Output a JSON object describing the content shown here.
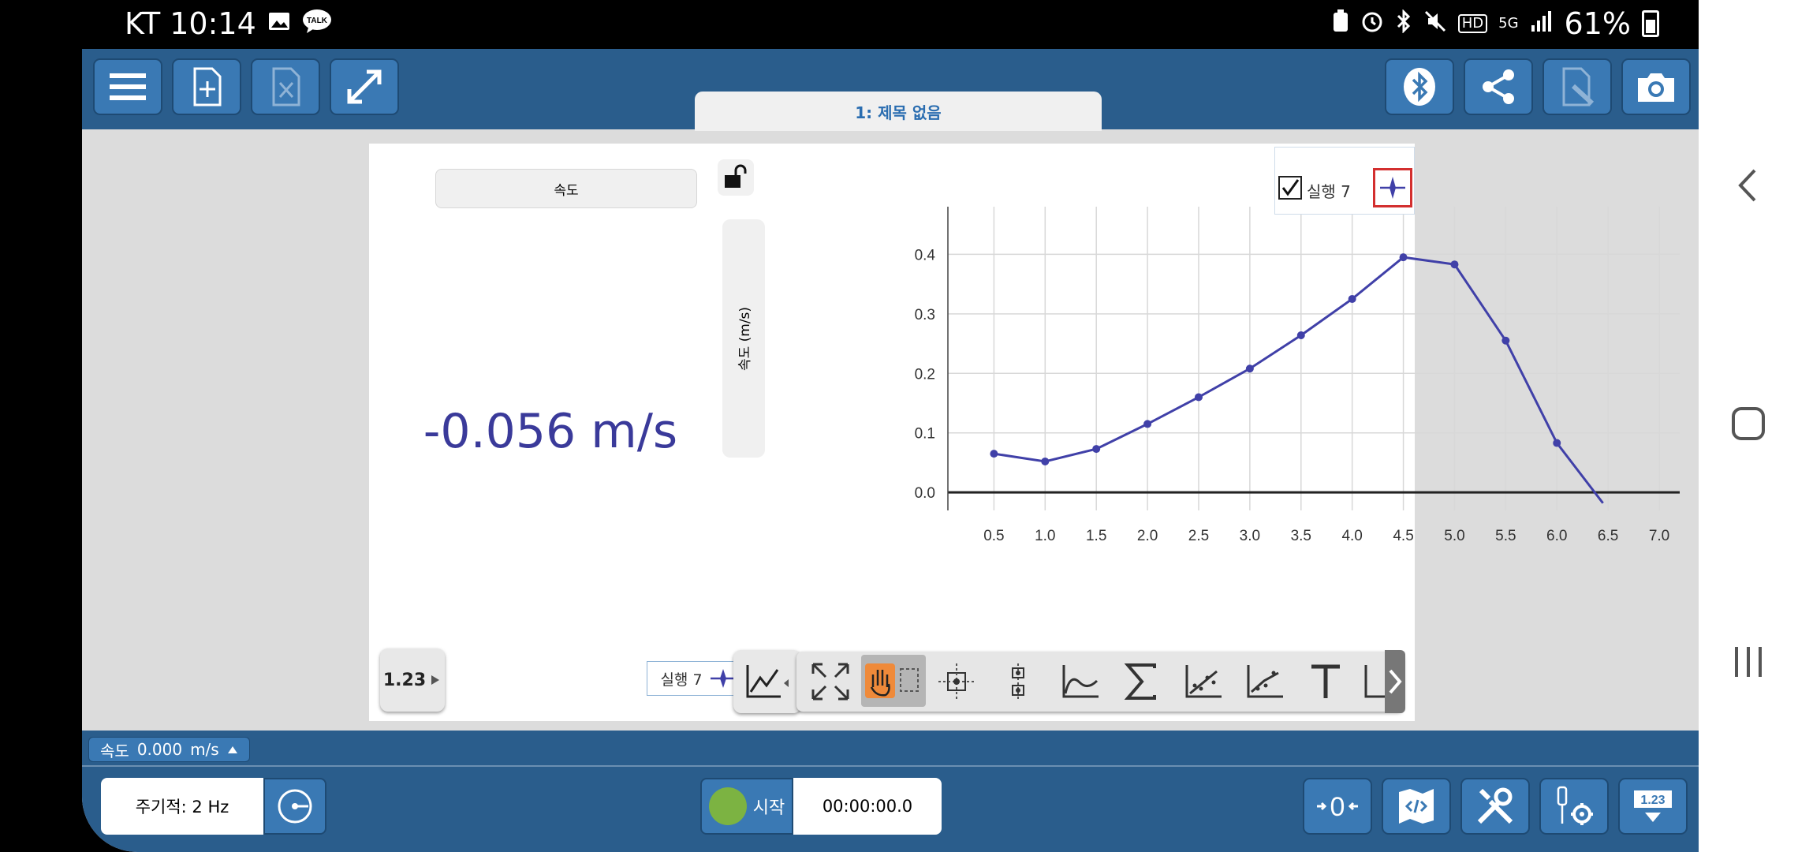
{
  "status_bar": {
    "carrier_time": "KT 10:14",
    "battery": "61%",
    "icons": [
      "image-icon",
      "talk-icon",
      "recycle-icon",
      "alarm-icon",
      "bluetooth-icon",
      "mute-icon",
      "hd-icon",
      "5g-icon",
      "signal-icon",
      "battery-icon"
    ],
    "talk_label": "TALK",
    "hd_label": "HD",
    "network_label": "5G"
  },
  "toolbar": {
    "buttons": [
      "menu-icon",
      "new-file-icon",
      "delete-file-icon",
      "expand-icon",
      "bluetooth-icon",
      "share-icon",
      "file-edit-icon",
      "camera-icon"
    ]
  },
  "doc_tab": {
    "title": "1: 제목 없음"
  },
  "meter": {
    "title": "속도",
    "value": "-0.056 m/s",
    "axis_label": "속도 (m/s)",
    "digits_button": "1.23",
    "run_chip": "실행 7"
  },
  "legend": {
    "run_label": "실행 7",
    "checked": true
  },
  "chart_data": {
    "type": "line",
    "x": [
      0.5,
      1.0,
      1.5,
      2.0,
      2.5,
      3.0,
      3.5,
      4.0,
      4.5,
      5.0,
      5.5,
      6.0,
      6.45
    ],
    "series": [
      {
        "name": "실행 7",
        "values": [
          0.065,
          0.052,
          0.073,
          0.115,
          0.16,
          0.208,
          0.264,
          0.325,
          0.395,
          0.383,
          0.255,
          0.083,
          -0.018
        ]
      }
    ],
    "markers_x": [
      0.5,
      1.0,
      1.5,
      2.0,
      2.5,
      3.0,
      3.5,
      4.0,
      4.5,
      5.0,
      5.5,
      6.0
    ],
    "xticks": [
      "0.5",
      "1.0",
      "1.5",
      "2.0",
      "2.5",
      "3.0",
      "3.5",
      "4.0",
      "4.5",
      "5.0",
      "5.5",
      "6.0",
      "6.5",
      "7.0"
    ],
    "yticks": [
      "0.0",
      "0.1",
      "0.2",
      "0.3",
      "0.4"
    ],
    "xlim": [
      0.05,
      7.2
    ],
    "ylim": [
      -0.017,
      0.48
    ],
    "grid": true,
    "legend_position": "top-right",
    "line_color": "#4040a8"
  },
  "tools": [
    "graph-options-icon",
    "autoscale-icon",
    "pan-zoom-icon",
    "examine-icon",
    "tangent-icon",
    "curve-fit-icon",
    "sum-icon",
    "linear-fit-icon",
    "scatter-fit-icon",
    "text-annotation-icon",
    "more-tools-icon"
  ],
  "sensor_bar": {
    "label": "속도",
    "value": "0.000",
    "unit": "m/s"
  },
  "controls": {
    "rate": "주기적: 2 Hz",
    "start": "시작",
    "timer": "00:00:00.0",
    "zero_label": "0",
    "digits_label": "1.23",
    "buttons": [
      "zero-icon",
      "code-icon",
      "tools-icon",
      "sensor-settings-icon",
      "display-digits-icon"
    ]
  },
  "colors": {
    "toolbar_bg": "#2a5d8c",
    "button_bg": "#3a79b4",
    "accent": "#4040a8",
    "start_green": "#7cb342"
  }
}
